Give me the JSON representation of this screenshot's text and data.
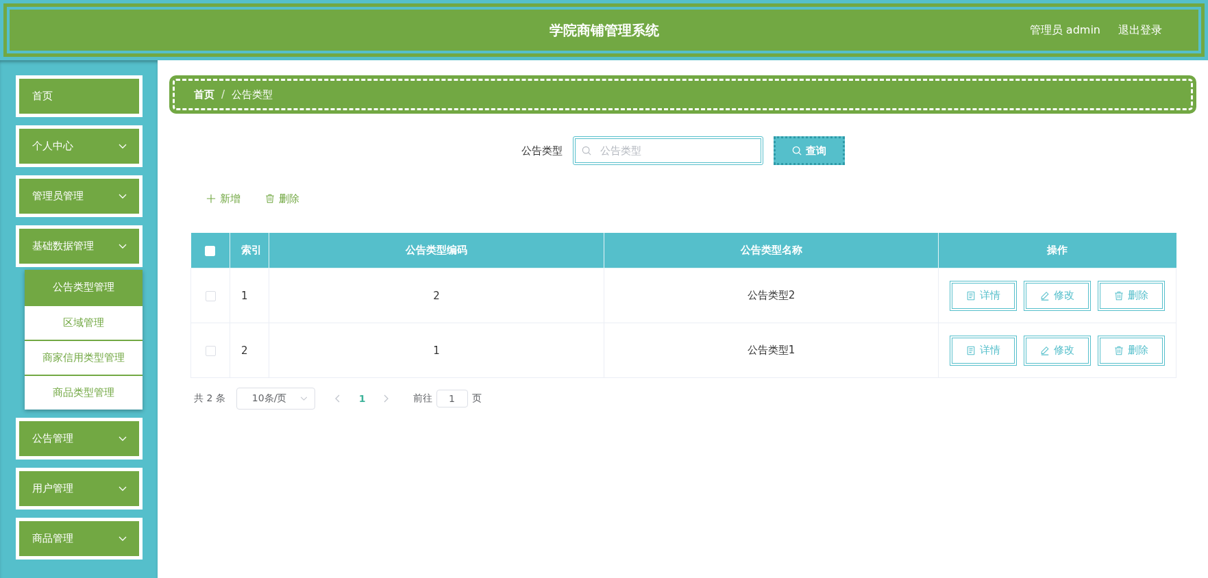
{
  "header": {
    "title": "学院商铺管理系统",
    "user": "管理员 admin",
    "logout": "退出登录"
  },
  "sidebar": {
    "items": [
      {
        "label": "首页",
        "kind": "link"
      },
      {
        "label": "个人中心",
        "kind": "submenu"
      },
      {
        "label": "管理员管理",
        "kind": "submenu"
      },
      {
        "label": "基础数据管理",
        "kind": "submenu",
        "children": [
          {
            "label": "公告类型管理",
            "selected": true
          },
          {
            "label": "区域管理",
            "selected": false
          },
          {
            "label": "商家信用类型管理",
            "selected": false
          },
          {
            "label": "商品类型管理",
            "selected": false
          }
        ]
      },
      {
        "label": "公告管理",
        "kind": "submenu"
      },
      {
        "label": "用户管理",
        "kind": "submenu"
      },
      {
        "label": "商品管理",
        "kind": "submenu"
      }
    ]
  },
  "breadcrumb": {
    "separator": "/",
    "items": [
      {
        "label": "首页",
        "kind": "link"
      },
      {
        "label": "公告类型",
        "kind": "current"
      }
    ]
  },
  "search": {
    "label": "公告类型",
    "placeholder": "公告类型",
    "button": "查询"
  },
  "toolbar": [
    {
      "kind": "add",
      "label": "新增"
    },
    {
      "kind": "delete",
      "label": "删除"
    }
  ],
  "table": {
    "select_all": {
      "checked": false
    },
    "columns": [
      "索引",
      "公告类型编码",
      "公告类型名称",
      "操作"
    ],
    "rows": [
      {
        "checked": false,
        "cells": [
          "1",
          "2",
          "公告类型2"
        ],
        "actions": [
          {
            "kind": "detail",
            "label": "详情"
          },
          {
            "kind": "edit",
            "label": "修改"
          },
          {
            "kind": "delete",
            "label": "删除"
          }
        ]
      },
      {
        "checked": false,
        "cells": [
          "2",
          "1",
          "公告类型1"
        ],
        "actions": [
          {
            "kind": "detail",
            "label": "详情"
          },
          {
            "kind": "edit",
            "label": "修改"
          },
          {
            "kind": "delete",
            "label": "删除"
          }
        ]
      }
    ]
  },
  "pagination": {
    "total": "共 2 条",
    "page_size": "10条/页",
    "pages": [
      {
        "label": "1",
        "selected": true
      }
    ],
    "goto_label": "前往",
    "goto_value": "1",
    "goto_suffix": "页"
  }
}
